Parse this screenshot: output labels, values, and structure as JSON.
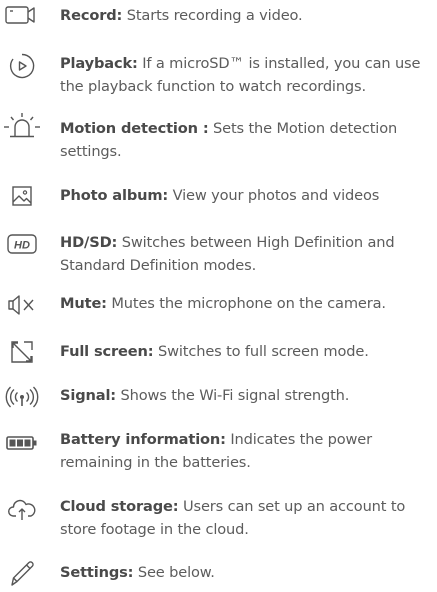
{
  "items": [
    {
      "icon": "record-icon",
      "label": "Record:",
      "description": " Starts recording a video."
    },
    {
      "icon": "playback-icon",
      "label": "Playback:",
      "description": " If a microSD™ is installed, you can use the playback function to watch recordings."
    },
    {
      "icon": "motion-detection-icon",
      "label": "Motion detection :",
      "description": " Sets the Motion detection settings."
    },
    {
      "icon": "photo-album-icon",
      "label": "Photo album:",
      "description": " View your photos and videos"
    },
    {
      "icon": "hd-icon",
      "label": "HD/SD:",
      "description": " Switches between High Definition and Standard Definition modes."
    },
    {
      "icon": "mute-icon",
      "label": "Mute:",
      "description": " Mutes the microphone on the camera."
    },
    {
      "icon": "full-screen-icon",
      "label": "Full screen:",
      "description": " Switches to full screen mode."
    },
    {
      "icon": "signal-icon",
      "label": "Signal:",
      "description": " Shows the Wi-Fi signal strength."
    },
    {
      "icon": "battery-icon",
      "label": "Battery information:",
      "description": " Indicates the power remaining in the batteries."
    },
    {
      "icon": "cloud-storage-icon",
      "label": "Cloud storage:",
      "description": " Users can set up an account to store footage in the cloud."
    },
    {
      "icon": "settings-icon",
      "label": "Settings:",
      "description": " See below."
    }
  ],
  "icon_labels": {
    "hd": "HD"
  },
  "colors": {
    "text": "#5c5c5c",
    "label": "#4a4a4a",
    "icon": "#555555"
  }
}
